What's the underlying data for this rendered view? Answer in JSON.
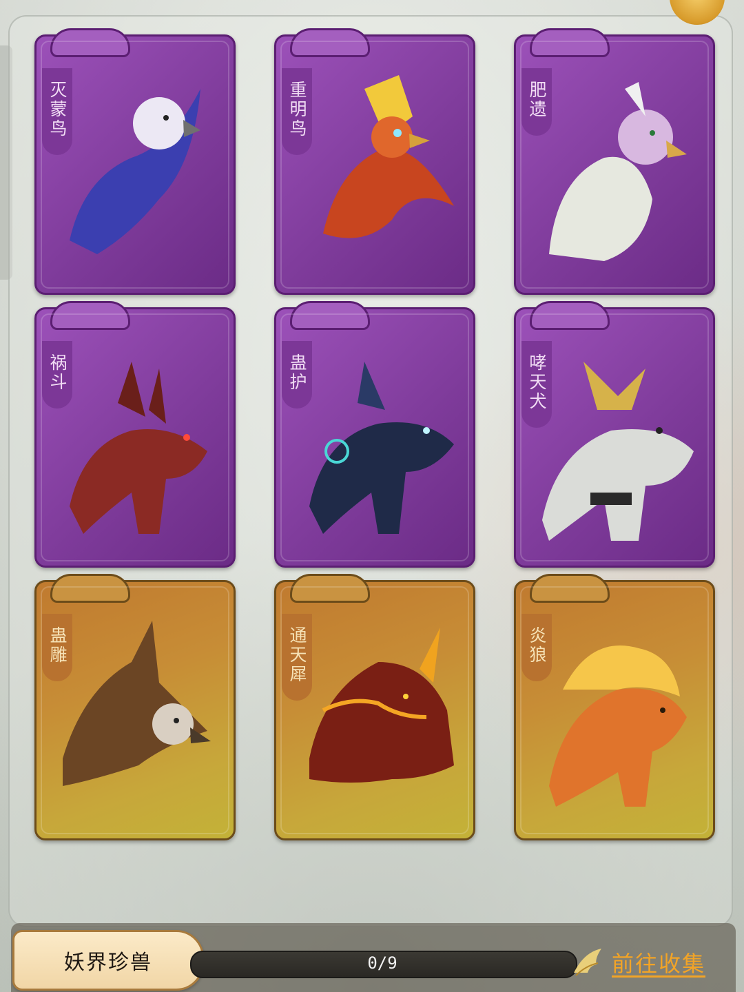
{
  "cards": [
    {
      "name": "灭蒙鸟",
      "rarity": "purple",
      "icon": "phoenix-blue-icon"
    },
    {
      "name": "重明鸟",
      "rarity": "purple",
      "icon": "phoenix-red-icon"
    },
    {
      "name": "肥遗",
      "rarity": "purple",
      "icon": "griffin-icon"
    },
    {
      "name": "祸斗",
      "rarity": "purple",
      "icon": "red-wolf-icon"
    },
    {
      "name": "蛊护",
      "rarity": "purple",
      "icon": "blue-wolf-icon"
    },
    {
      "name": "哮天犬",
      "rarity": "purple",
      "icon": "white-wolf-icon"
    },
    {
      "name": "蛊雕",
      "rarity": "gold",
      "icon": "eagle-icon"
    },
    {
      "name": "通天犀",
      "rarity": "gold",
      "icon": "rhino-icon"
    },
    {
      "name": "炎狼",
      "rarity": "gold",
      "icon": "fire-wolf-icon"
    }
  ],
  "footer": {
    "title": "妖界珍兽",
    "progress_text": "0/9",
    "progress_fraction": 0,
    "collect_label": "前往收集"
  }
}
